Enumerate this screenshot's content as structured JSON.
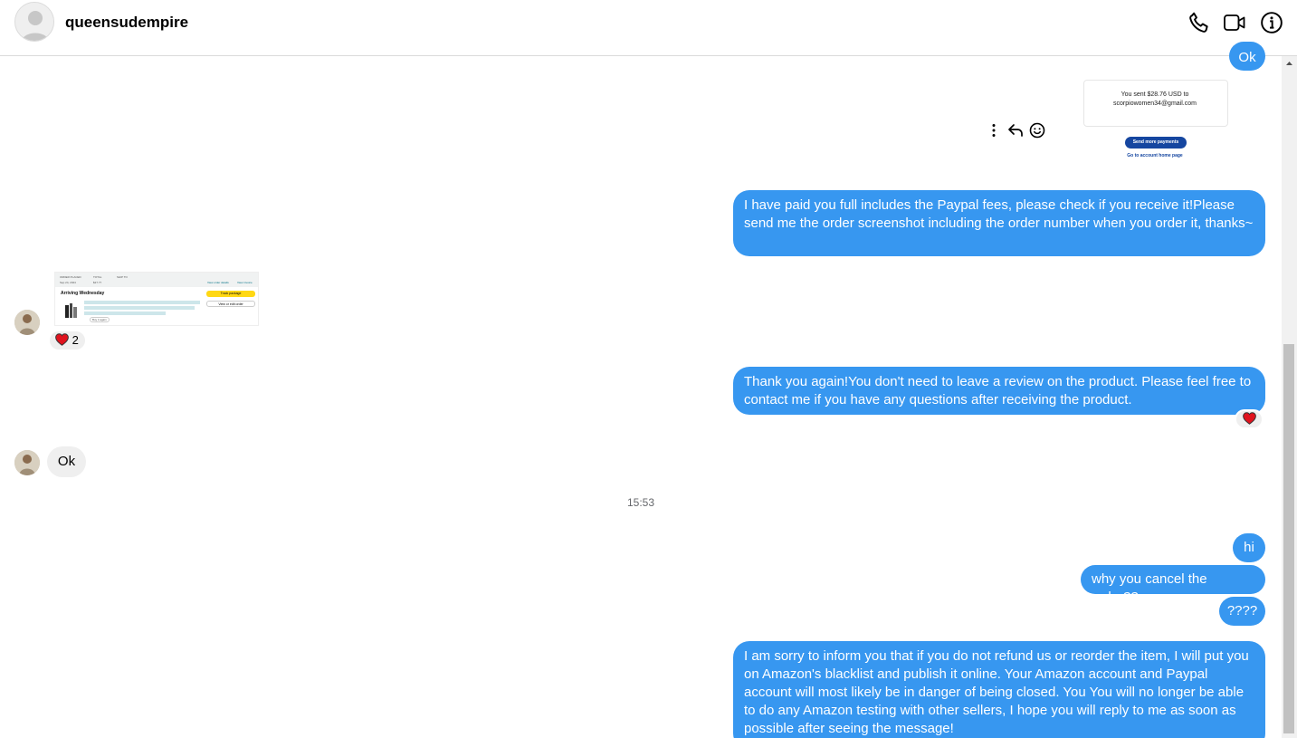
{
  "header": {
    "username": "queensudempire",
    "icons": {
      "call": "phone-icon",
      "video": "video-camera-icon",
      "info": "info-icon"
    }
  },
  "colors": {
    "outgoing_bubble": "#3797f0",
    "incoming_bubble": "#efefef",
    "heart": "#e0131e",
    "paypal_button": "#1546a0"
  },
  "messages": {
    "top_partial": "Ok",
    "payment_screenshot": {
      "sent_line1": "You sent $28.76 USD to",
      "sent_line2": "scorpiowomen34@gmail.com",
      "button": "Send more payments",
      "link": "Go to account home page"
    },
    "paid_msg": "I have paid you full includes the Paypal fees, please check if you receive it!Please send me the order screenshot including the order number when you order it, thanks~",
    "order_screenshot": {
      "heading": "Arriving Wednesday",
      "yellow_button": "Track package",
      "white_button": "View or edit order",
      "buy_again": "Buy it again",
      "order_placed": "ORDER PLACED",
      "order_date": "Sep 24, 2024",
      "total_label": "TOTAL",
      "total_value": "$27.77",
      "ship_to": "SHIP TO",
      "view_details": "View order details",
      "view_invoice": "View invoice"
    },
    "order_reaction_count": "2",
    "thanks_msg": "Thank you again!You don't need to leave a review on the product. Please feel free to contact me if you have any questions after receiving the product.",
    "reply_ok": "Ok",
    "timestamp": "15:53",
    "hi": "hi",
    "why_cancel": "why you cancel the order??",
    "question_marks": "????",
    "warning_msg": "I am sorry to inform you that if you do not refund us or reorder the item, I will put you on Amazon's blacklist and publish it online. Your Amazon account and Paypal account will most likely be in danger of being closed. You You will no longer be able to do any Amazon testing with other sellers, I hope you will reply to me as soon as possible after seeing the message!"
  },
  "message_actions": [
    "more-options-icon",
    "reply-icon",
    "emoji-icon"
  ]
}
